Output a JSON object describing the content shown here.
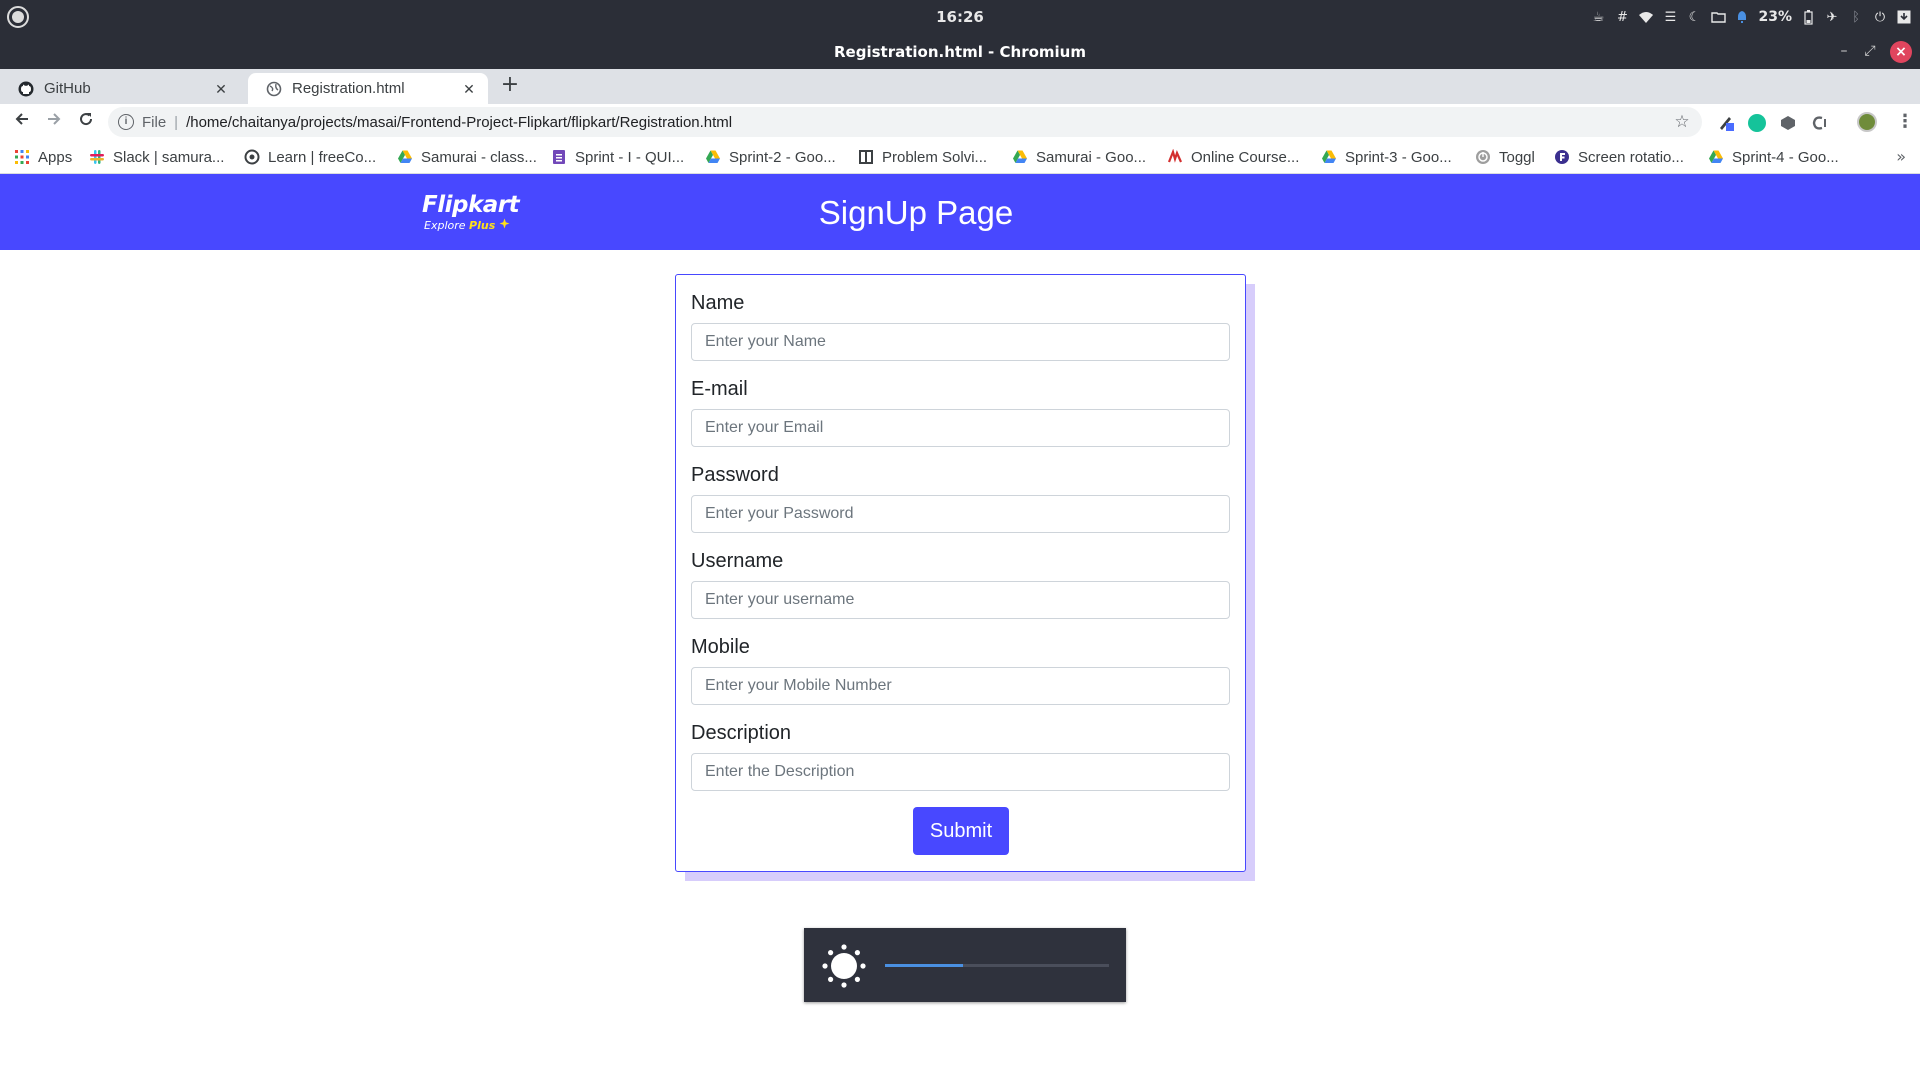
{
  "os": {
    "clock": "16:26",
    "battery_percent": "23%"
  },
  "window": {
    "title": "Registration.html - Chromium"
  },
  "tabs": [
    {
      "label": "GitHub",
      "icon": "github-icon",
      "active": false
    },
    {
      "label": "Registration.html",
      "icon": "globe-icon",
      "active": true
    }
  ],
  "toolbar": {
    "scheme": "File",
    "url": "/home/chaitanya/projects/masai/Frontend-Project-Flipkart/flipkart/Registration.html"
  },
  "bookmarks": [
    {
      "label": "Apps",
      "icon": "apps-grid-icon"
    },
    {
      "label": "Slack | samura...",
      "icon": "slack-icon"
    },
    {
      "label": "Learn | freeCo...",
      "icon": "freecodecamp-icon"
    },
    {
      "label": "Samurai - class...",
      "icon": "google-drive-icon"
    },
    {
      "label": "Sprint - I - QUI...",
      "icon": "google-forms-icon"
    },
    {
      "label": "Sprint-2 - Goo...",
      "icon": "google-drive-icon"
    },
    {
      "label": "Problem Solvi...",
      "icon": "problem-solving-icon"
    },
    {
      "label": "Samurai - Goo...",
      "icon": "google-drive-icon"
    },
    {
      "label": "Online Course...",
      "icon": "online-course-icon"
    },
    {
      "label": "Sprint-3 - Goo...",
      "icon": "google-drive-icon"
    },
    {
      "label": "Toggl",
      "icon": "toggl-icon"
    },
    {
      "label": "Screen rotatio...",
      "icon": "screen-rotation-icon"
    },
    {
      "label": "Sprint-4 - Goo...",
      "icon": "google-drive-icon"
    }
  ],
  "header": {
    "logo_text": "Flipkart",
    "logo_sub": "Explore",
    "logo_plus": "Plus",
    "title": "SignUp Page",
    "background_color": "#4848ff"
  },
  "form": {
    "fields": [
      {
        "label": "Name",
        "placeholder": "Enter your Name"
      },
      {
        "label": "E-mail",
        "placeholder": "Enter your Email"
      },
      {
        "label": "Password",
        "placeholder": "Enter your Password"
      },
      {
        "label": "Username",
        "placeholder": "Enter your username"
      },
      {
        "label": "Mobile",
        "placeholder": "Enter your Mobile Number"
      },
      {
        "label": "Description",
        "placeholder": "Enter the Description"
      }
    ],
    "submit_label": "Submit",
    "accent_color": "#4848ff"
  },
  "brightness_osd": {
    "icon": "brightness-sun-icon",
    "level": 0.35
  }
}
